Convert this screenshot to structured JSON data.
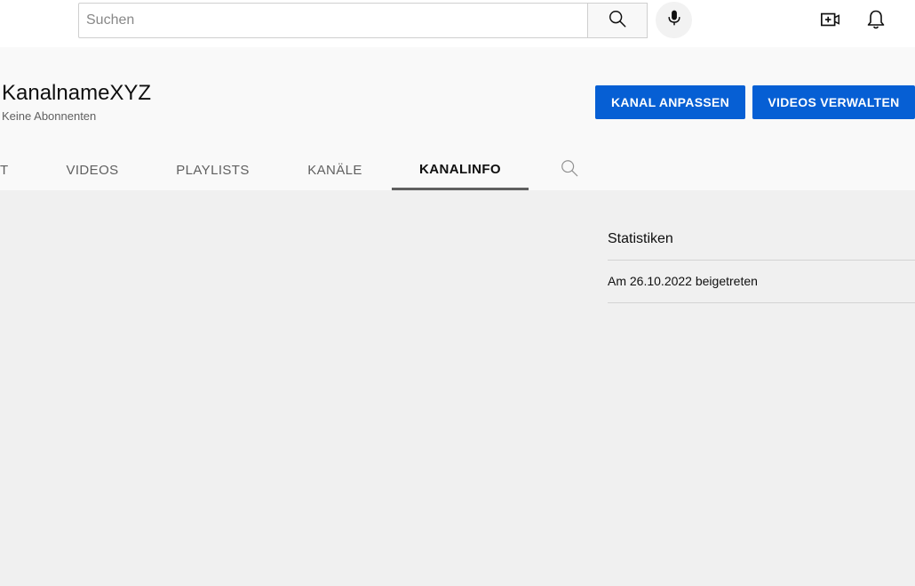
{
  "search": {
    "placeholder": "Suchen",
    "value": ""
  },
  "icons": {
    "search": "search-icon",
    "mic": "microphone-icon",
    "create": "create-video-icon",
    "notifications": "bell-icon",
    "tab_search": "search-icon"
  },
  "channel": {
    "name": "KanalnameXYZ",
    "subscribers": "Keine Abonnenten"
  },
  "actions": {
    "customize": "KANAL ANPASSEN",
    "manage": "VIDEOS VERWALTEN"
  },
  "tabs": [
    {
      "label": "T",
      "active": false
    },
    {
      "label": "VIDEOS",
      "active": false
    },
    {
      "label": "PLAYLISTS",
      "active": false
    },
    {
      "label": "KANÄLE",
      "active": false
    },
    {
      "label": "KANALINFO",
      "active": true
    }
  ],
  "stats": {
    "title": "Statistiken",
    "joined": "Am 26.10.2022 beigetreten"
  },
  "colors": {
    "accent": "#065fd4",
    "page_background": "#f0f0f0",
    "header_background": "#f9f9f9"
  }
}
